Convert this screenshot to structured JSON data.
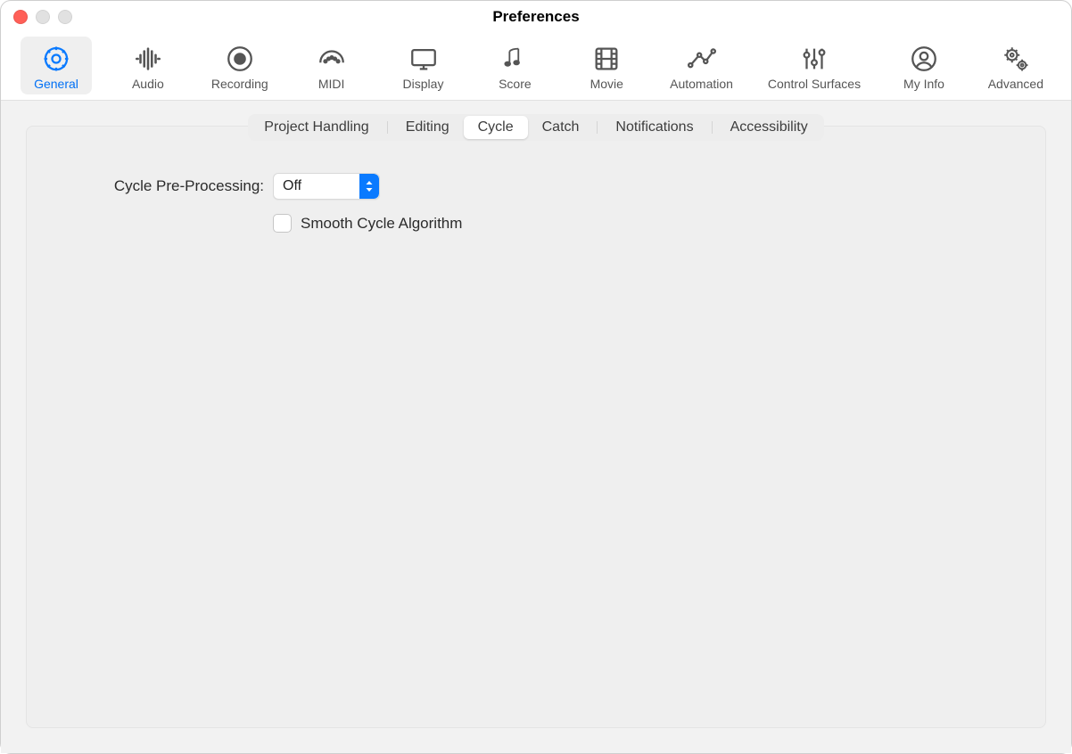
{
  "window": {
    "title": "Preferences"
  },
  "toolbar": [
    {
      "id": "general",
      "label": "General"
    },
    {
      "id": "audio",
      "label": "Audio"
    },
    {
      "id": "recording",
      "label": "Recording"
    },
    {
      "id": "midi",
      "label": "MIDI"
    },
    {
      "id": "display",
      "label": "Display"
    },
    {
      "id": "score",
      "label": "Score"
    },
    {
      "id": "movie",
      "label": "Movie"
    },
    {
      "id": "automation",
      "label": "Automation"
    },
    {
      "id": "control-surfaces",
      "label": "Control Surfaces"
    },
    {
      "id": "my-info",
      "label": "My Info"
    },
    {
      "id": "advanced",
      "label": "Advanced"
    }
  ],
  "toolbar_selected": "general",
  "subtabs": [
    {
      "id": "project-handling",
      "label": "Project Handling"
    },
    {
      "id": "editing",
      "label": "Editing"
    },
    {
      "id": "cycle",
      "label": "Cycle"
    },
    {
      "id": "catch",
      "label": "Catch"
    },
    {
      "id": "notifications",
      "label": "Notifications"
    },
    {
      "id": "accessibility",
      "label": "Accessibility"
    }
  ],
  "subtab_selected": "cycle",
  "form": {
    "cycle_pre_processing": {
      "label": "Cycle Pre-Processing:",
      "value": "Off"
    },
    "smooth_cycle": {
      "label": "Smooth Cycle Algorithm",
      "checked": false
    }
  }
}
